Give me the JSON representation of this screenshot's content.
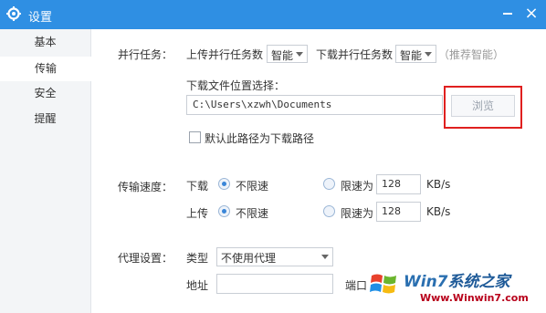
{
  "window": {
    "title": "设置",
    "icons": {
      "settings": "gear-icon",
      "minimize": "minimize-icon",
      "close": "close-icon"
    },
    "colors": {
      "titlebar": "#2f8fe3",
      "highlight": "#e0201f",
      "radio": "#3a86d8"
    }
  },
  "sidebar": {
    "items": [
      {
        "label": "基本",
        "active": false
      },
      {
        "label": "传输",
        "active": true
      },
      {
        "label": "安全",
        "active": false
      },
      {
        "label": "提醒",
        "active": false
      }
    ]
  },
  "parallel": {
    "section_label": "并行任务：",
    "upload_label": "上传并行任务数",
    "upload_value": "智能",
    "download_label": "下载并行任务数",
    "download_value": "智能",
    "hint": "（推荐智能）"
  },
  "download_location": {
    "label": "下载文件位置选择：",
    "path": "C:\\Users\\xzwh\\Documents",
    "browse_label": "浏览",
    "default_checkbox_label": "默认此路径为下载路径",
    "default_checked": false
  },
  "speed": {
    "section_label": "传输速度：",
    "rows": [
      {
        "direction": "下载",
        "unlimited_label": "不限速",
        "limit_label": "限速为",
        "limit_value": "128",
        "unit": "KB/s",
        "selected": "unlimited"
      },
      {
        "direction": "上传",
        "unlimited_label": "不限速",
        "limit_label": "限速为",
        "limit_value": "128",
        "unit": "KB/s",
        "selected": "unlimited"
      }
    ]
  },
  "proxy": {
    "section_label": "代理设置：",
    "type_label": "类型",
    "type_value": "不使用代理",
    "address_label": "地址",
    "address_value": "",
    "port_label": "端口"
  },
  "watermark": {
    "brand_latin": "Win7",
    "brand_cn": "系统之家",
    "url": "Www.Winwin7.com"
  }
}
